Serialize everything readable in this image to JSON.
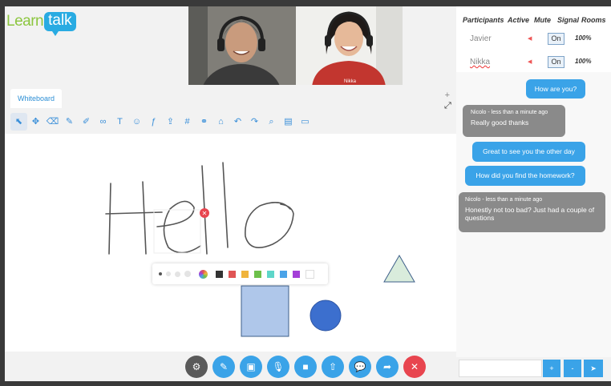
{
  "logo": {
    "learn": "Learn",
    "talk": "talk"
  },
  "videos": [
    {
      "name": "Javier"
    },
    {
      "name": "Nikka"
    }
  ],
  "whiteboard": {
    "tab_label": "Whiteboard",
    "add_label": "+",
    "expand_label": "⤢"
  },
  "toolbar": [
    {
      "name": "select-tool-icon",
      "glyph": "⬉"
    },
    {
      "name": "move-tool-icon",
      "glyph": "✥"
    },
    {
      "name": "eraser-tool-icon",
      "glyph": "⌫"
    },
    {
      "name": "pen-tool-icon",
      "glyph": "✎"
    },
    {
      "name": "highlighter-tool-icon",
      "glyph": "✐"
    },
    {
      "name": "link-tool-icon",
      "glyph": "∞"
    },
    {
      "name": "text-tool-icon",
      "glyph": "T"
    },
    {
      "name": "emoji-tool-icon",
      "glyph": "☺"
    },
    {
      "name": "formula-tool-icon",
      "glyph": "ƒ"
    },
    {
      "name": "upload-tool-icon",
      "glyph": "⇪"
    },
    {
      "name": "grid-tool-icon",
      "glyph": "#"
    },
    {
      "name": "chain-tool-icon",
      "glyph": "⚭"
    },
    {
      "name": "delete-tool-icon",
      "glyph": "⌂"
    },
    {
      "name": "undo-tool-icon",
      "glyph": "↶"
    },
    {
      "name": "redo-tool-icon",
      "glyph": "↷"
    },
    {
      "name": "zoom-tool-icon",
      "glyph": "⌕"
    },
    {
      "name": "save-tool-icon",
      "glyph": "▤"
    },
    {
      "name": "screen-tool-icon",
      "glyph": "▭"
    }
  ],
  "palette": {
    "colors": [
      "#333333",
      "#e05555",
      "#f0b43c",
      "#6cc04a",
      "#5ed6c9",
      "#4aa3e8",
      "#a43fd8",
      "#ffffff"
    ]
  },
  "canvas": {
    "close_label": "✕"
  },
  "bottom_buttons": [
    {
      "name": "settings-button",
      "icon": "gear-icon",
      "glyph": "⚙",
      "color": "#5a5a5a"
    },
    {
      "name": "edit-button",
      "icon": "pencil-icon",
      "glyph": "✎",
      "color": "#3aa3e8"
    },
    {
      "name": "whiteboard-button",
      "icon": "picture-icon",
      "glyph": "▣",
      "color": "#3aa3e8"
    },
    {
      "name": "mic-button",
      "icon": "microphone-icon",
      "glyph": "🎙",
      "color": "#3aa3e8"
    },
    {
      "name": "camera-button",
      "icon": "video-camera-icon",
      "glyph": "■",
      "color": "#3aa3e8"
    },
    {
      "name": "screenshare-button",
      "icon": "upload-icon",
      "glyph": "⇧",
      "color": "#3aa3e8"
    },
    {
      "name": "chat-button",
      "icon": "chat-icon",
      "glyph": "💬",
      "color": "#3aa3e8"
    },
    {
      "name": "share-button",
      "icon": "share-arrow-icon",
      "glyph": "➦",
      "color": "#3aa3e8"
    },
    {
      "name": "end-call-button",
      "icon": "close-icon",
      "glyph": "✕",
      "color": "#e8454f"
    }
  ],
  "participants": {
    "headers": [
      "Participants",
      "Active",
      "Mute",
      "Signal",
      "Rooms"
    ],
    "rows": [
      {
        "name": "Javier",
        "mute": "◀",
        "toggle": "On",
        "signal": "100%"
      },
      {
        "name": "Nikka",
        "mute": "◀",
        "toggle": "On",
        "signal": "100%"
      }
    ]
  },
  "chat": {
    "messages": [
      {
        "from": "me",
        "text": "How are you?"
      },
      {
        "from": "them",
        "meta": "Nicolo - less than a minute ago",
        "text": "Really good thanks"
      },
      {
        "from": "me",
        "text": "Great to see you the other day"
      },
      {
        "from": "me",
        "text": "How did you find the homework?"
      },
      {
        "from": "them",
        "meta": "Nicolo - less than a minute ago",
        "text": "Honestly not too bad? Just had a couple of questions"
      }
    ],
    "input_placeholder": "",
    "plus_label": "+",
    "minus_label": "-",
    "send_glyph": "➤"
  },
  "colors": {
    "accent": "#3aa3e8",
    "end_call": "#e8454f",
    "logo_green": "#8cc63f",
    "bubble_grey": "#8a8a8a"
  }
}
